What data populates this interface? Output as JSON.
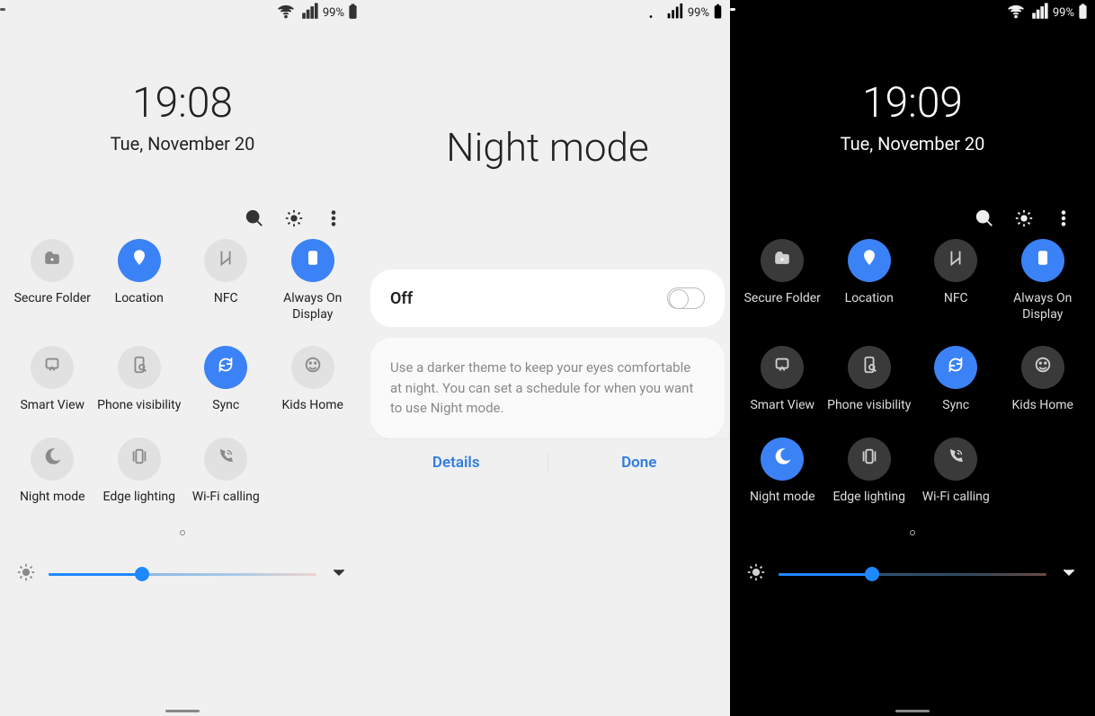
{
  "status": {
    "battery": "99%"
  },
  "left": {
    "time": "19:08",
    "date": "Tue, November 20",
    "brightness_pct": 35,
    "tiles": [
      {
        "name": "secure-folder",
        "label": "Secure Folder",
        "on": false,
        "icon": "folder-lock"
      },
      {
        "name": "location",
        "label": "Location",
        "on": true,
        "icon": "pin"
      },
      {
        "name": "nfc",
        "label": "NFC",
        "on": false,
        "icon": "nfc"
      },
      {
        "name": "always-on-display",
        "label": "Always On Display",
        "on": true,
        "icon": "aod"
      },
      {
        "name": "smart-view",
        "label": "Smart View",
        "on": false,
        "icon": "cast"
      },
      {
        "name": "phone-visibility",
        "label": "Phone visibility",
        "on": false,
        "icon": "phone-search"
      },
      {
        "name": "sync",
        "label": "Sync",
        "on": true,
        "icon": "sync"
      },
      {
        "name": "kids-home",
        "label": "Kids Home",
        "on": false,
        "icon": "face"
      },
      {
        "name": "night-mode",
        "label": "Night mode",
        "on": false,
        "icon": "moon"
      },
      {
        "name": "edge-lighting",
        "label": "Edge lighting",
        "on": false,
        "icon": "edge"
      },
      {
        "name": "wifi-calling",
        "label": "Wi-Fi calling",
        "on": false,
        "icon": "wifi-call"
      }
    ]
  },
  "middle": {
    "title": "Night mode",
    "toggle_label": "Off",
    "toggle_on": false,
    "description": "Use a darker theme to keep your eyes comfortable at night. You can set a schedule for when you want to use Night mode.",
    "btn_details": "Details",
    "btn_done": "Done"
  },
  "right": {
    "time": "19:09",
    "date": "Tue, November 20",
    "brightness_pct": 35,
    "tiles": [
      {
        "name": "secure-folder",
        "label": "Secure Folder",
        "on": false,
        "icon": "folder-lock"
      },
      {
        "name": "location",
        "label": "Location",
        "on": true,
        "icon": "pin"
      },
      {
        "name": "nfc",
        "label": "NFC",
        "on": false,
        "icon": "nfc"
      },
      {
        "name": "always-on-display",
        "label": "Always On Display",
        "on": true,
        "icon": "aod"
      },
      {
        "name": "smart-view",
        "label": "Smart View",
        "on": false,
        "icon": "cast"
      },
      {
        "name": "phone-visibility",
        "label": "Phone visibility",
        "on": false,
        "icon": "phone-search"
      },
      {
        "name": "sync",
        "label": "Sync",
        "on": true,
        "icon": "sync"
      },
      {
        "name": "kids-home",
        "label": "Kids Home",
        "on": false,
        "icon": "face"
      },
      {
        "name": "night-mode",
        "label": "Night mode",
        "on": true,
        "icon": "moon"
      },
      {
        "name": "edge-lighting",
        "label": "Edge lighting",
        "on": false,
        "icon": "edge"
      },
      {
        "name": "wifi-calling",
        "label": "Wi-Fi calling",
        "on": false,
        "icon": "wifi-call"
      }
    ]
  }
}
